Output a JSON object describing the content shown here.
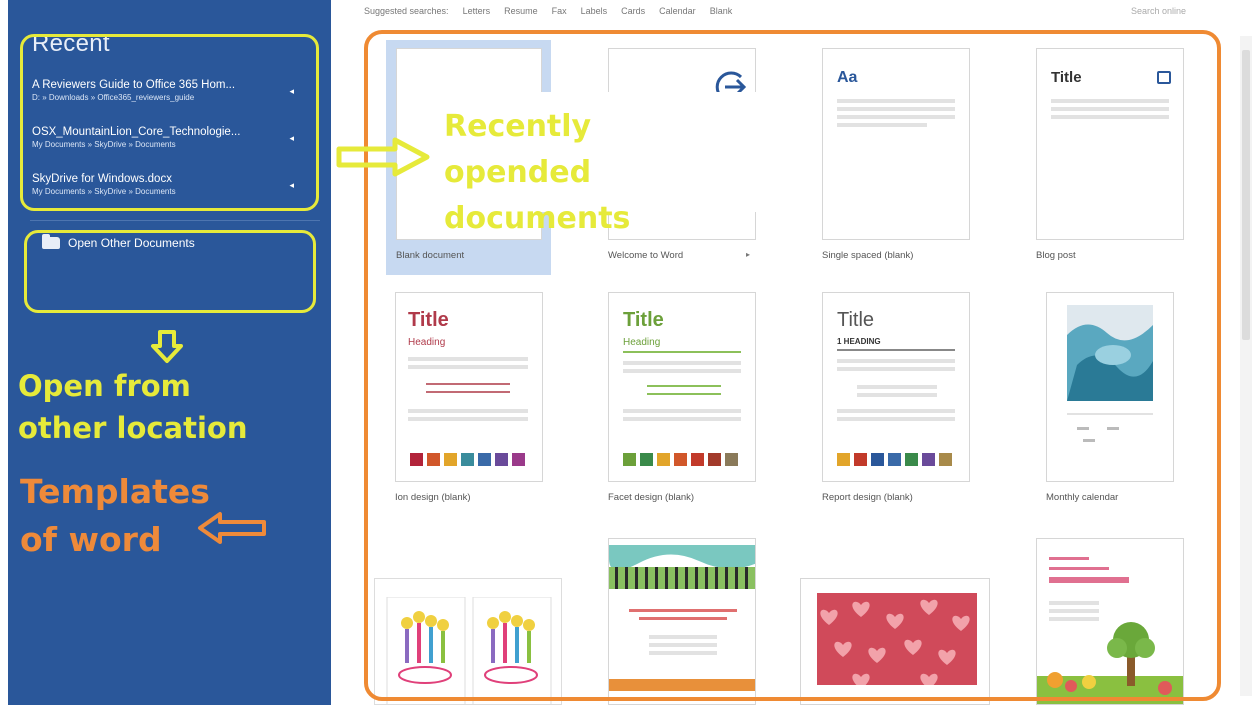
{
  "sidebar": {
    "recent_title": "Recent",
    "recent_items": [
      {
        "name": "A Reviewers Guide to Office 365 Hom...",
        "path": "D: » Downloads » Office365_reviewers_guide"
      },
      {
        "name": "OSX_MountainLion_Core_Technologie...",
        "path": "My Documents » SkyDrive » Documents"
      },
      {
        "name": "SkyDrive for Windows.docx",
        "path": "My Documents » SkyDrive » Documents"
      }
    ],
    "open_other_label": "Open Other Documents"
  },
  "annotations": {
    "recently_opened": "Recently opended documents",
    "open_from_other": "Open from other location",
    "templates_of_word": "Templates of word"
  },
  "topbar": {
    "items": [
      "Suggested searches:",
      "Letters",
      "Resume",
      "Fax",
      "Labels",
      "Cards",
      "Calendar",
      "Blank"
    ],
    "search_label": "Search online"
  },
  "templates": [
    {
      "label": "Blank document"
    },
    {
      "label": "Welcome to Word"
    },
    {
      "label": "Single spaced (blank)",
      "sample": "Aa"
    },
    {
      "label": "Blog post",
      "sample": "Title"
    },
    {
      "label": "Ion design (blank)",
      "title": "Title",
      "heading": "Heading"
    },
    {
      "label": "Facet design (blank)",
      "title": "Title",
      "heading": "Heading"
    },
    {
      "label": "Report design (blank)",
      "title": "Title",
      "heading": "1  HEADING"
    },
    {
      "label": "Monthly calendar"
    }
  ],
  "colors": {
    "sidebar": "#2a579a",
    "highlight_yellow": "#e6ea3a",
    "annotation_orange": "#ee8a3a",
    "selected_tile": "#c7d9f1"
  },
  "icons": {
    "pin": "pin-icon",
    "folder": "folder-icon",
    "welcome_arrow": "circle-arrow-icon"
  }
}
